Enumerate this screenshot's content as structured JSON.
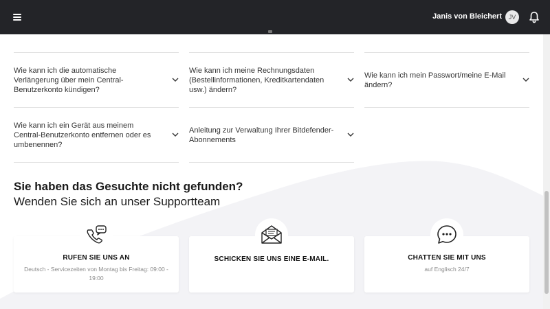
{
  "header": {
    "user_name": "Janis von Bleichert",
    "avatar_initials": "JV",
    "icons": [
      "hamburger-menu-icon",
      "bell-icon"
    ]
  },
  "faq": {
    "items": [
      {
        "text": "Wie kann ich die automatische Verlängerung über mein Central-Benutzerkonto kündigen?"
      },
      {
        "text": "Wie kann ich meine Rechnungsdaten (Bestellinformationen, Kreditkartendaten usw.) ändern?"
      },
      {
        "text": "Wie kann ich mein Passwort/meine E-Mail ändern?"
      },
      {
        "text": "Wie kann ich ein Gerät aus meinem Central-Benutzerkonto entfernen oder es umbenennen?"
      },
      {
        "text": "Anleitung zur Verwaltung Ihrer Bitdefender-Abonnements"
      }
    ]
  },
  "support": {
    "title": "Sie haben das Gesuchte nicht gefunden?",
    "subtitle": "Wenden Sie sich an unser Supportteam",
    "cards": [
      {
        "title": "RUFEN SIE UNS AN",
        "subtitle": "Deutsch - Servicezeiten von Montag bis Freitag: 09:00 - 19:00",
        "icon": "phone-chat-icon"
      },
      {
        "title": "SCHICKEN SIE UNS EINE E-MAIL.",
        "subtitle": "",
        "icon": "envelope-icon"
      },
      {
        "title": "CHATTEN SIE MIT UNS",
        "subtitle": "auf Englisch 24/7",
        "icon": "chat-bubble-icon"
      }
    ]
  },
  "colors": {
    "topbar": "#232428",
    "wave": "#f3f3f6",
    "divider": "#e2e2e2"
  }
}
